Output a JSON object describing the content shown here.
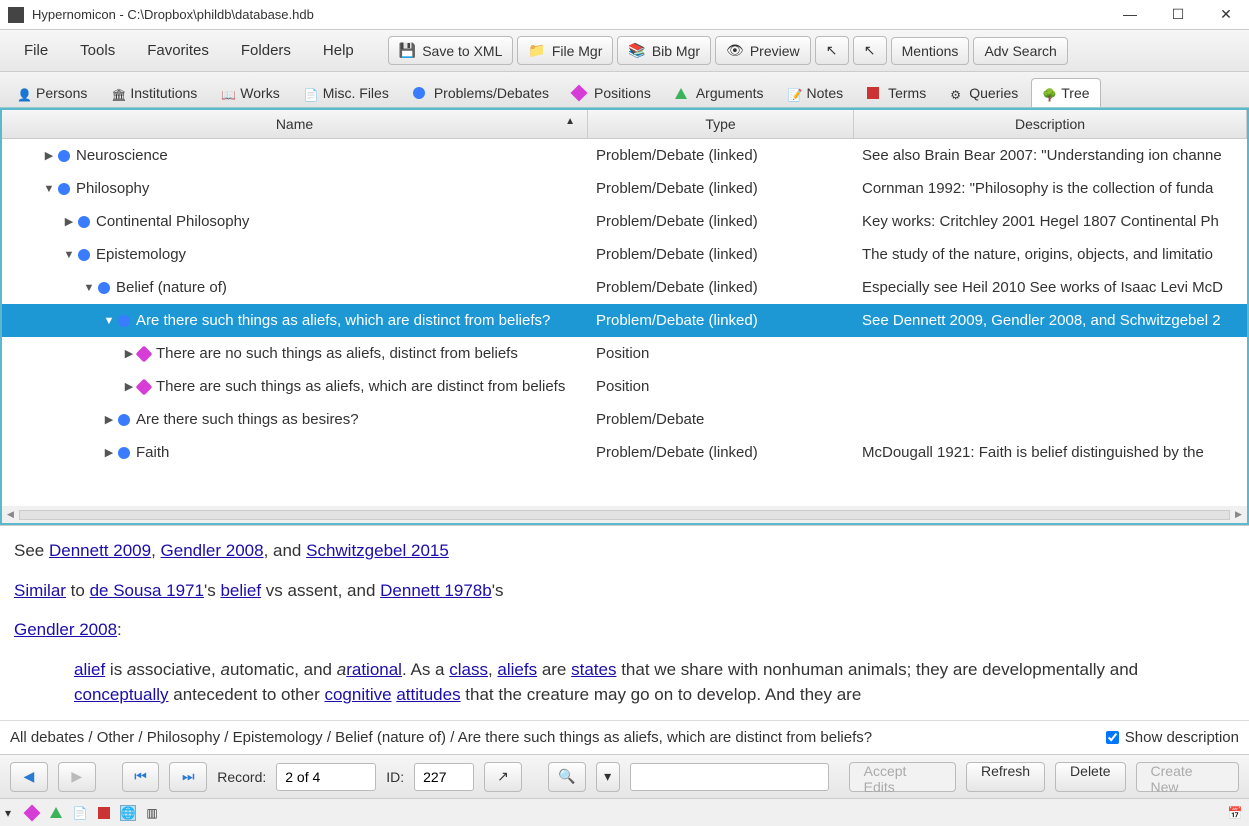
{
  "window": {
    "title": "Hypernomicon - C:\\Dropbox\\phildb\\database.hdb"
  },
  "menu": {
    "file": "File",
    "tools": "Tools",
    "favorites": "Favorites",
    "folders": "Folders",
    "help": "Help"
  },
  "toolbar": {
    "save_xml": "Save to XML",
    "file_mgr": "File Mgr",
    "bib_mgr": "Bib Mgr",
    "preview": "Preview",
    "mentions": "Mentions",
    "adv_search": "Adv Search"
  },
  "tabs": {
    "persons": "Persons",
    "institutions": "Institutions",
    "works": "Works",
    "misc_files": "Misc. Files",
    "problems": "Problems/Debates",
    "positions": "Positions",
    "arguments": "Arguments",
    "notes": "Notes",
    "terms": "Terms",
    "queries": "Queries",
    "tree": "Tree"
  },
  "tree": {
    "cols": {
      "name": "Name",
      "type": "Type",
      "desc": "Description"
    },
    "rows": [
      {
        "indent": 1,
        "exp": "▶",
        "icon": "debate",
        "name": "Neuroscience",
        "type": "Problem/Debate (linked)",
        "desc": "See also Brain Bear 2007: \"Understanding ion channe"
      },
      {
        "indent": 1,
        "exp": "▼",
        "icon": "debate",
        "name": "Philosophy",
        "type": "Problem/Debate (linked)",
        "desc": "Cornman 1992: \"Philosophy is the collection of funda"
      },
      {
        "indent": 2,
        "exp": "▶",
        "icon": "debate",
        "name": "Continental Philosophy",
        "type": "Problem/Debate (linked)",
        "desc": "Key works: Critchley 2001 Hegel 1807 Continental Ph"
      },
      {
        "indent": 2,
        "exp": "▼",
        "icon": "debate",
        "name": "Epistemology",
        "type": "Problem/Debate (linked)",
        "desc": "The study of the nature, origins, objects, and limitatio"
      },
      {
        "indent": 3,
        "exp": "▼",
        "icon": "debate",
        "name": "Belief (nature of)",
        "type": "Problem/Debate (linked)",
        "desc": "Especially see Heil 2010 See works of Isaac Levi McD"
      },
      {
        "indent": 4,
        "exp": "▼",
        "icon": "debate",
        "name": "Are there such things as aliefs, which are distinct from beliefs?",
        "type": "Problem/Debate (linked)",
        "desc": "See Dennett 2009, Gendler 2008, and Schwitzgebel 2",
        "sel": true
      },
      {
        "indent": 5,
        "exp": "▶",
        "icon": "pos",
        "name": "There are no such things as aliefs, distinct from beliefs",
        "type": "Position",
        "desc": ""
      },
      {
        "indent": 5,
        "exp": "▶",
        "icon": "pos",
        "name": "There are such things as aliefs, which are distinct from beliefs",
        "type": "Position",
        "desc": ""
      },
      {
        "indent": 4,
        "exp": "▶",
        "icon": "debate",
        "name": "Are there such things as besires?",
        "type": "Problem/Debate",
        "desc": ""
      },
      {
        "indent": 4,
        "exp": "▶",
        "icon": "debate",
        "name": "Faith",
        "type": "Problem/Debate (linked)",
        "desc": "McDougall 1921: Faith is belief distinguished by the"
      }
    ]
  },
  "description": {
    "line1_pre": "See ",
    "l1a": "Dennett 2009",
    "l1_mid1": ", ",
    "l1b": "Gendler 2008",
    "l1_mid2": ", and ",
    "l1c": "Schwitzgebel 2015",
    "l2a": "Similar",
    "l2_mid1": " to ",
    "l2b": "de Sousa 1971",
    "l2_mid2": "'s ",
    "l2c": "belief",
    "l2_mid3": " vs assent, and ",
    "l2d": "Dennett 1978b",
    "l2_end": "'s",
    "l3a": "Gendler 2008",
    "l3_end": ":",
    "p4_a": "alief",
    "p4_t1": " is ",
    "p4_i1": "a",
    "p4_t2": "ssociative, ",
    "p4_i2": "a",
    "p4_t3": "utomatic, and ",
    "p4_i3": "a",
    "p4_b": "rational",
    "p4_t4": ". As a ",
    "p4_c": "class",
    "p4_t5": ", ",
    "p4_d": "aliefs",
    "p4_t6": " are ",
    "p4_e": "states",
    "p4_t7": " that we share with nonhuman animals; they are developmentally and ",
    "p4_f": "conceptually",
    "p4_t8": " antecedent to other ",
    "p4_g": "cognitive",
    "p4_t9": " ",
    "p4_h": "attitudes",
    "p4_t10": " that the creature may go on to develop. And they are"
  },
  "breadcrumb": "All debates / Other / Philosophy / Epistemology / Belief (nature of) / Are there such things as aliefs, which are distinct from beliefs?",
  "show_desc_label": "Show description",
  "bottom": {
    "record_label": "Record:",
    "record_val": "2 of 4",
    "id_label": "ID:",
    "id_val": "227",
    "accept": "Accept Edits",
    "refresh": "Refresh",
    "delete": "Delete",
    "create": "Create New"
  }
}
